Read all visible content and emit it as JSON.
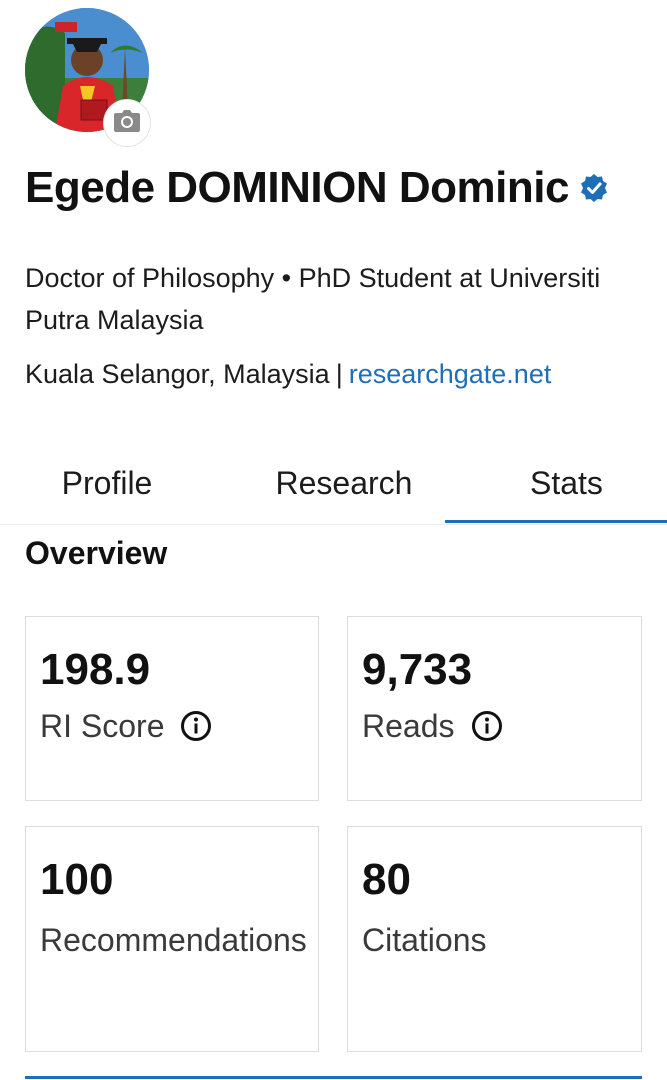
{
  "profile": {
    "name": "Egede DOMINION Dominic",
    "headline": "Doctor of Philosophy • PhD Student at Universiti Putra Malaysia",
    "location": "Kuala Selangor, Malaysia",
    "separator": "|",
    "website": "researchgate.net",
    "verified_icon": "verified-badge-icon",
    "camera_icon": "camera-icon"
  },
  "tabs": [
    {
      "label": "Profile",
      "active": false
    },
    {
      "label": "Research",
      "active": false
    },
    {
      "label": "Stats",
      "active": true
    }
  ],
  "overview": {
    "title": "Overview",
    "cards": [
      {
        "value": "198.9",
        "label": "RI Score",
        "info_icon": true
      },
      {
        "value": "9,733",
        "label": "Reads",
        "info_icon": true
      },
      {
        "value": "100",
        "label": "Recommendations",
        "info_icon": false
      },
      {
        "value": "80",
        "label": "Citations",
        "info_icon": false
      }
    ]
  },
  "colors": {
    "accent": "#1f6fb8",
    "text": "#111111",
    "card_border": "#dcdcdc"
  }
}
